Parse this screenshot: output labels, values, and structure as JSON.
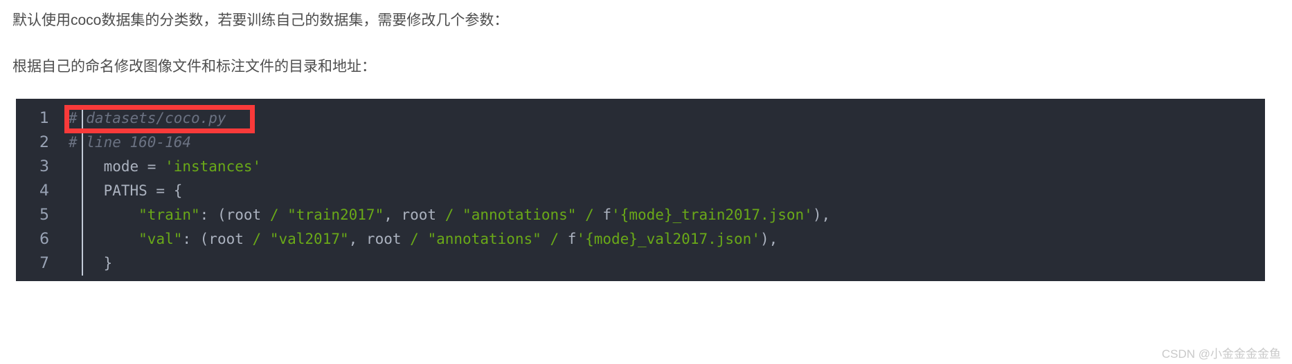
{
  "document": {
    "paragraphs": [
      "默认使用coco数据集的分类数，若要训练自己的数据集，需要修改几个参数：",
      "根据自己的命名修改图像文件和标注文件的目录和地址："
    ]
  },
  "code_block": {
    "language": "python",
    "background_color": "#282c35",
    "line_number_color": "#99a3b5",
    "lines": [
      {
        "number": "1",
        "tokens": [
          {
            "text": "# datasets/coco.py",
            "type": "comment"
          }
        ]
      },
      {
        "number": "2",
        "tokens": [
          {
            "text": "# line 160-164",
            "type": "comment"
          }
        ]
      },
      {
        "number": "3",
        "tokens": [
          {
            "text": "    mode = ",
            "type": "plain"
          },
          {
            "text": "'instances'",
            "type": "string"
          }
        ]
      },
      {
        "number": "4",
        "tokens": [
          {
            "text": "    PATHS = {",
            "type": "plain"
          }
        ]
      },
      {
        "number": "5",
        "tokens": [
          {
            "text": "        ",
            "type": "plain"
          },
          {
            "text": "\"train\"",
            "type": "string"
          },
          {
            "text": ": (root ",
            "type": "plain"
          },
          {
            "text": "/",
            "type": "string"
          },
          {
            "text": " ",
            "type": "plain"
          },
          {
            "text": "\"train2017\"",
            "type": "string"
          },
          {
            "text": ", root ",
            "type": "plain"
          },
          {
            "text": "/",
            "type": "string"
          },
          {
            "text": " ",
            "type": "plain"
          },
          {
            "text": "\"annotations\"",
            "type": "string"
          },
          {
            "text": " ",
            "type": "plain"
          },
          {
            "text": "/",
            "type": "string"
          },
          {
            "text": " f",
            "type": "plain"
          },
          {
            "text": "'{mode}_train2017.json'",
            "type": "string"
          },
          {
            "text": "),",
            "type": "plain"
          }
        ]
      },
      {
        "number": "6",
        "tokens": [
          {
            "text": "        ",
            "type": "plain"
          },
          {
            "text": "\"val\"",
            "type": "string"
          },
          {
            "text": ": (root ",
            "type": "plain"
          },
          {
            "text": "/",
            "type": "string"
          },
          {
            "text": " ",
            "type": "plain"
          },
          {
            "text": "\"val2017\"",
            "type": "string"
          },
          {
            "text": ", root ",
            "type": "plain"
          },
          {
            "text": "/",
            "type": "string"
          },
          {
            "text": " ",
            "type": "plain"
          },
          {
            "text": "\"annotations\"",
            "type": "string"
          },
          {
            "text": " ",
            "type": "plain"
          },
          {
            "text": "/",
            "type": "string"
          },
          {
            "text": " f",
            "type": "plain"
          },
          {
            "text": "'{mode}_val2017.json'",
            "type": "string"
          },
          {
            "text": "),",
            "type": "plain"
          }
        ]
      },
      {
        "number": "7",
        "tokens": [
          {
            "text": "    }",
            "type": "plain"
          }
        ]
      }
    ]
  },
  "annotation": {
    "highlight_box_color": "#f93a3a",
    "highlight_target_line": "1"
  },
  "watermark": {
    "text": "CSDN @小金金金金鱼"
  }
}
